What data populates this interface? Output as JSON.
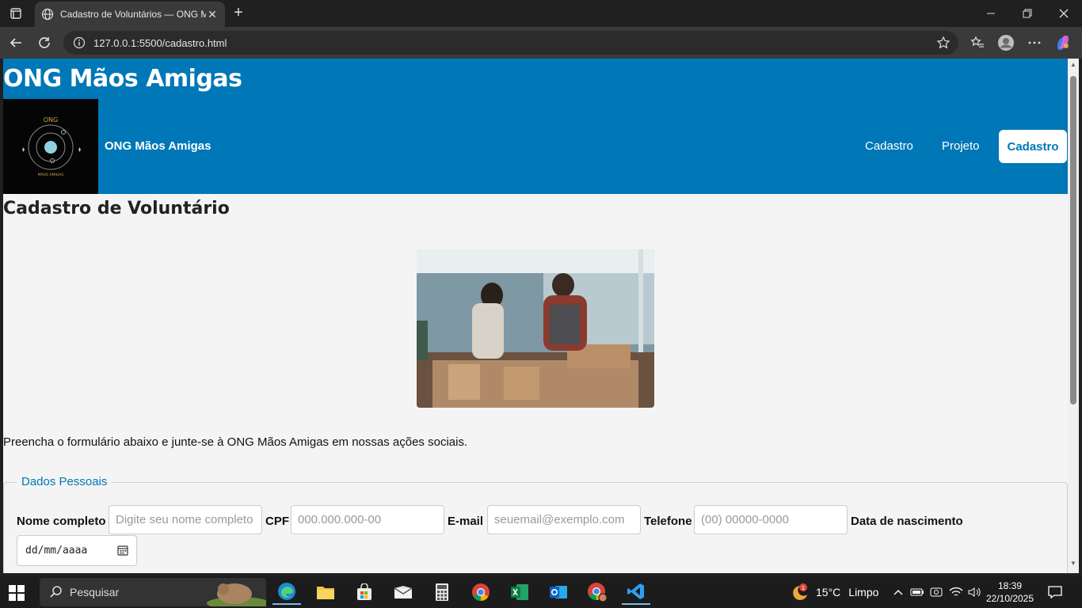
{
  "browser": {
    "tab_title": "Cadastro de Voluntários — ONG M",
    "url": "127.0.0.1:5500/cadastro.html"
  },
  "site": {
    "title": "ONG Mãos Amigas",
    "logo_top": "ONG",
    "logo_bottom": "MÃOS AMIGAS",
    "brand_name": "ONG Mãos Amigas",
    "nav": [
      {
        "label": "Cadastro"
      },
      {
        "label": "Projeto"
      },
      {
        "label": "Cadastro"
      }
    ],
    "accent_color": "#0077b6"
  },
  "page": {
    "heading": "Cadastro de Voluntário",
    "intro": "Preencha o formulário abaixo e junte-se à ONG Mãos Amigas em nossas ações sociais.",
    "fieldset_legend": "Dados Pessoais",
    "fields": {
      "name_label": "Nome completo",
      "name_placeholder": "Digite seu nome completo",
      "cpf_label": "CPF",
      "cpf_placeholder": "000.000.000-00",
      "email_label": "E-mail",
      "email_placeholder": "seuemail@exemplo.com",
      "phone_label": "Telefone",
      "phone_placeholder": "(00) 00000-0000",
      "birth_label": "Data de nascimento",
      "birth_value": "dd/mm/aaaa"
    }
  },
  "taskbar": {
    "search_placeholder": "Pesquisar",
    "weather": "15°C",
    "weather_desc": "Limpo",
    "weather_badge": "1",
    "time": "18:39",
    "date": "22/10/2025"
  }
}
